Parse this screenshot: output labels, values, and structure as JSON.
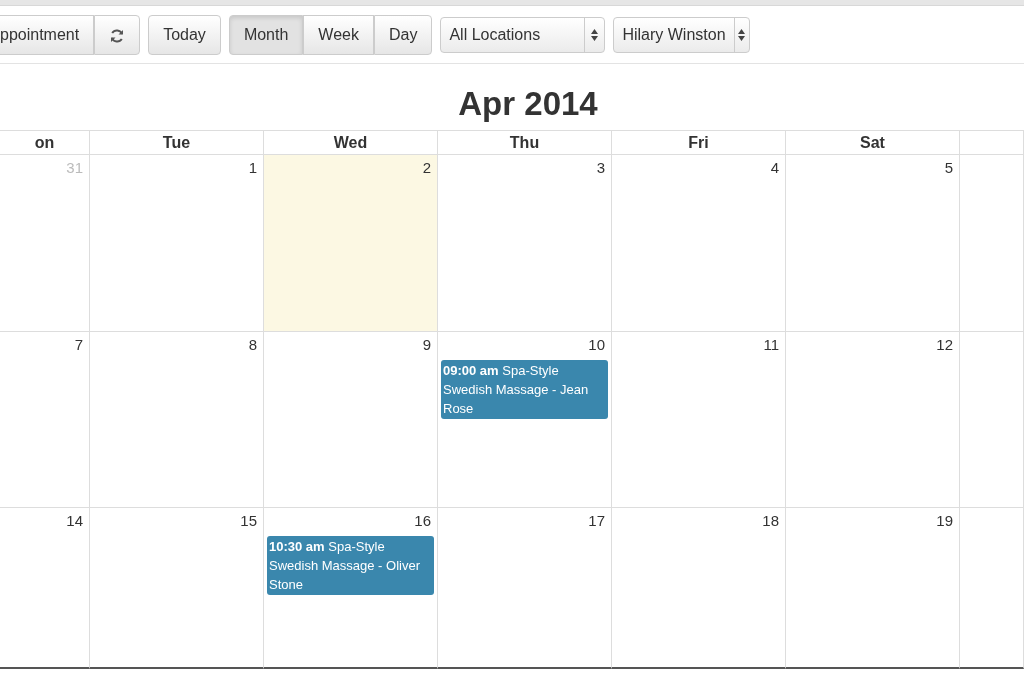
{
  "toolbar": {
    "new_button": "ppointment",
    "today_button": "Today",
    "views": [
      {
        "label": "Month",
        "selected": true
      },
      {
        "label": "Week",
        "selected": false
      },
      {
        "label": "Day",
        "selected": false
      }
    ],
    "location_select": "All Locations",
    "staff_select": "Hilary Winston"
  },
  "title": "Apr 2014",
  "weekdays": [
    "on",
    "Tue",
    "Wed",
    "Thu",
    "Fri",
    "Sat"
  ],
  "weeks": [
    {
      "days": [
        {
          "number": "31",
          "other_month": true,
          "today": false
        },
        {
          "number": "1",
          "other_month": false,
          "today": false
        },
        {
          "number": "2",
          "other_month": false,
          "today": true
        },
        {
          "number": "3",
          "other_month": false,
          "today": false
        },
        {
          "number": "4",
          "other_month": false,
          "today": false
        },
        {
          "number": "5",
          "other_month": false,
          "today": false
        }
      ]
    },
    {
      "days": [
        {
          "number": "7",
          "other_month": false,
          "today": false
        },
        {
          "number": "8",
          "other_month": false,
          "today": false
        },
        {
          "number": "9",
          "other_month": false,
          "today": false
        },
        {
          "number": "10",
          "other_month": false,
          "today": false,
          "events": [
            {
              "time": "09:00 am",
              "title": "Spa-Style Swedish Massage - Jean Rose"
            }
          ]
        },
        {
          "number": "11",
          "other_month": false,
          "today": false
        },
        {
          "number": "12",
          "other_month": false,
          "today": false
        }
      ]
    },
    {
      "days": [
        {
          "number": "14",
          "other_month": false,
          "today": false
        },
        {
          "number": "15",
          "other_month": false,
          "today": false
        },
        {
          "number": "16",
          "other_month": false,
          "today": false,
          "events": [
            {
              "time": "10:30 am",
              "title": "Spa-Style Swedish Massage - Oliver Stone"
            }
          ]
        },
        {
          "number": "17",
          "other_month": false,
          "today": false
        },
        {
          "number": "18",
          "other_month": false,
          "today": false
        },
        {
          "number": "19",
          "other_month": false,
          "today": false
        }
      ]
    }
  ]
}
